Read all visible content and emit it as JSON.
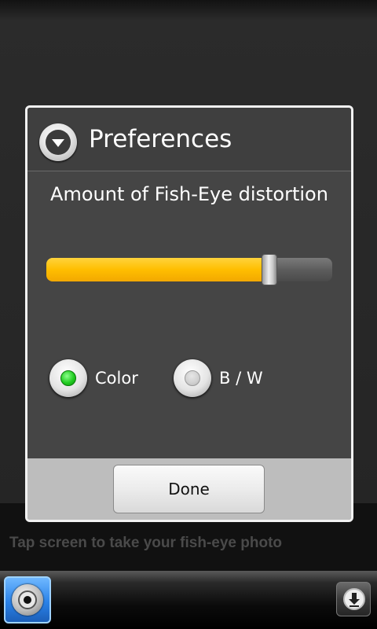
{
  "dialog": {
    "title": "Preferences",
    "label": "Amount of Fish-Eye distortion",
    "slider_value_percent": 78,
    "radios": [
      {
        "label": "Color",
        "selected": true
      },
      {
        "label": "B / W",
        "selected": false
      }
    ],
    "done_label": "Done"
  },
  "caption": "Tap screen to take your fish-eye photo",
  "colors": {
    "slider_fill": "#ffbe00",
    "radio_selected": "#21cc21",
    "camera_button": "#2a82e8"
  },
  "icons": {
    "dialog_icon": "chevron-down-circle-icon",
    "camera": "camera-lens-icon",
    "download": "download-arrow-icon"
  }
}
